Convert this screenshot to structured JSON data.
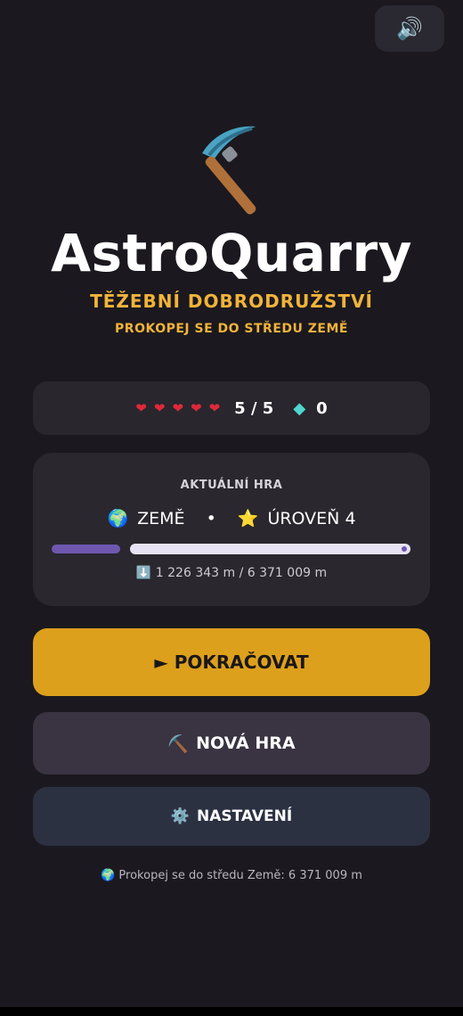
{
  "sound": {
    "icon": "speaker-icon",
    "glyph": "🔊"
  },
  "hero": {
    "icon": "pickaxe-icon",
    "title": "AstroQuarry",
    "subtitle": "TĚŽEBNÍ DOBRODRUŽSTVÍ",
    "tagline": "PROKOPEJ SE DO STŘEDU ZEMĚ"
  },
  "stats": {
    "hearts": 5,
    "lives_text": "5 / 5",
    "gem_icon": "gem-icon",
    "gem_glyph": "◆",
    "gems": "0"
  },
  "current_game": {
    "label": "AKTUÁLNÍ HRA",
    "planet_emoji": "🌍",
    "planet": "ZEMĚ",
    "separator": "•",
    "level_emoji": "⭐",
    "level": "ÚROVEŇ 4",
    "progress_fraction": 0.192,
    "depth_emoji": "⬇️",
    "depth_text": "1 226 343 m / 6 371 009 m"
  },
  "buttons": {
    "continue": "► POKRAČOVAT",
    "new_game_emoji": "⛏️",
    "new_game": "NOVÁ HRA",
    "settings_emoji": "⚙️",
    "settings": "NASTAVENÍ"
  },
  "footer": {
    "emoji": "🌍",
    "text": "Prokopej se do středu Země: 6 371 009 m"
  },
  "colors": {
    "background": "#1b191f",
    "accent": "#dda01d",
    "subtitle": "#f2b33a",
    "progress": "#6f57b0",
    "heart": "#e0283a"
  }
}
